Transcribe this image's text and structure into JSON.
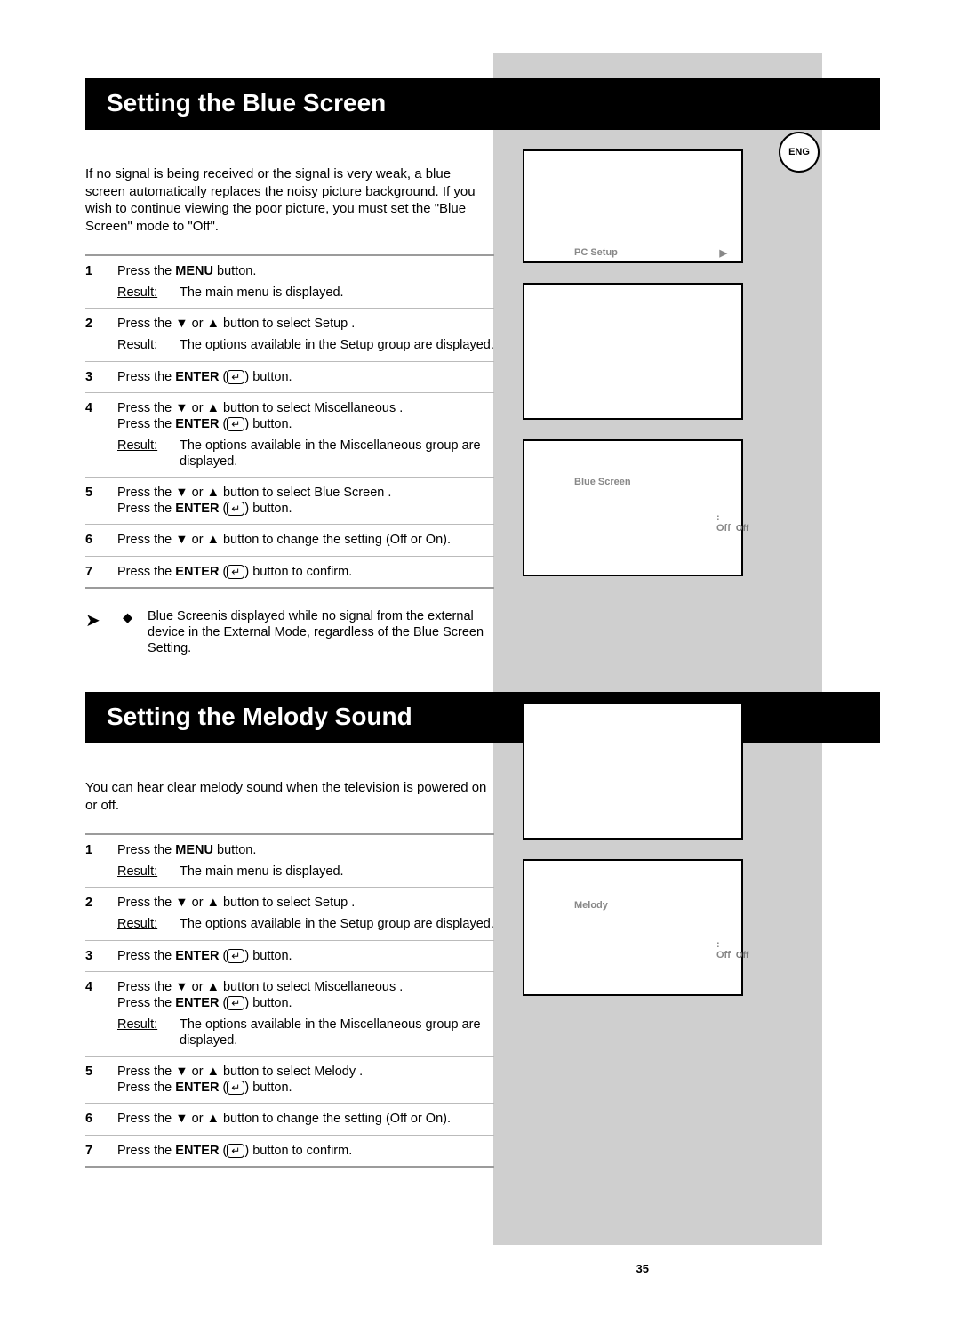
{
  "lang_badge": "ENG",
  "page_number": "35",
  "section1": {
    "title": "Setting the Blue Screen",
    "intro": "If no signal is being received or the signal is very weak, a blue screen automatically replaces the noisy picture background. If you wish to continue viewing the poor picture, you must set the \"Blue Screen\" mode to \"Off\".",
    "steps": {
      "n1": "1",
      "s1a": "Press the ",
      "s1b": "MENU",
      "s1c": " button.",
      "r1": "The main menu is displayed.",
      "n2": "2",
      "s2": "Press the ▼ or ▲ button to select Setup .",
      "r2": "The options available in the Setup   group are displayed.",
      "n3": "3",
      "s3a": "Press the ",
      "s3b": "ENTER",
      "s3c": " (",
      "s3d": ") button.",
      "n4": "4",
      "s4a": "Press the ▼ or ▲ button to select Miscellaneous     .",
      "s4b": "Press the ",
      "s4c": "ENTER",
      "s4d": " (",
      "s4e": ") button.",
      "r4": "The options available in the Miscellaneous      group are displayed.",
      "n5": "5",
      "s5a": "Press the ▼ or ▲ button to select Blue Screen    .",
      "s5b": "Press the ",
      "s5c": "ENTER",
      "s5d": " (",
      "s5e": ") button.",
      "n6": "6",
      "s6": "Press the ▼ or ▲ button to change the setting (Off   or On).",
      "n7": "7",
      "s7a": "Press the ",
      "s7b": "ENTER",
      "s7c": " (",
      "s7d": ") button to confirm."
    },
    "note": "Blue Screenis displayed while no signal from the external device in the External Mode, regardless of the Blue Screen Setting.",
    "result_label": "Result:",
    "enter_glyph": "↵"
  },
  "section2": {
    "title": "Setting the Melody Sound",
    "intro": "You can hear clear melody sound when the television is powered on or off.",
    "steps": {
      "n1": "1",
      "s1a": "Press the ",
      "s1b": "MENU",
      "s1c": " button.",
      "r1": "The main menu is displayed.",
      "n2": "2",
      "s2": "Press the ▼ or ▲ button to select Setup .",
      "r2": "The options available in the Setup   group are displayed.",
      "n3": "3",
      "s3a": "Press the ",
      "s3b": "ENTER",
      "s3c": " (",
      "s3d": ") button.",
      "n4": "4",
      "s4a": "Press the ▼ or ▲ button to select Miscellaneous     .",
      "s4b": "Press the ",
      "s4c": "ENTER",
      "s4d": " (",
      "s4e": ") button.",
      "r4": "The options available in the Miscellaneous      group are displayed.",
      "n5": "5",
      "s5a": "Press the ▼ or ▲ button to select Melody .",
      "s5b": "Press the ",
      "s5c": "ENTER",
      "s5d": " (",
      "s5e": ") button.",
      "n6": "6",
      "s6": "Press the ▼ or ▲ button to change the setting (Off   or On).",
      "n7": "7",
      "s7a": "Press the ",
      "s7b": "ENTER",
      "s7c": " (",
      "s7d": ") button to confirm."
    }
  },
  "osd": {
    "pc_setup": "PC Setup",
    "arrow": "▶",
    "blue_screen": "Blue Screen",
    "off": ": Off",
    "off2": "Off",
    "melody": "Melody"
  },
  "symbols": {
    "note_arrow": "➤",
    "bullet": "◆"
  }
}
